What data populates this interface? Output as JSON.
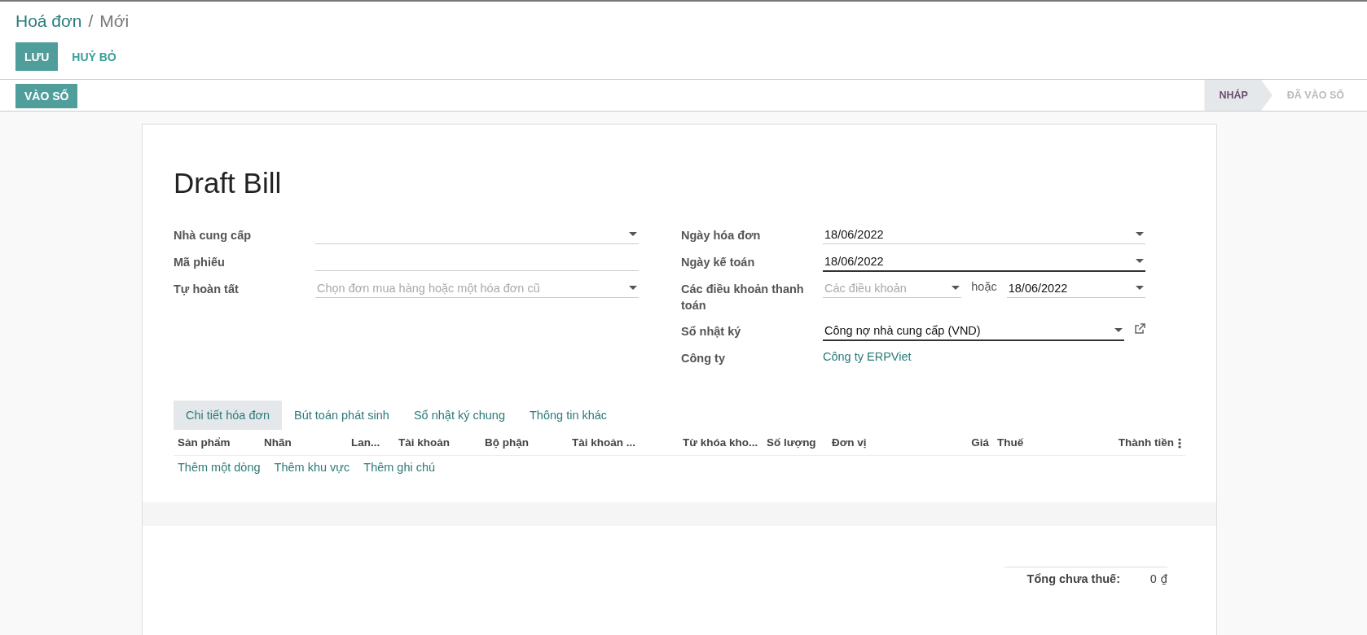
{
  "breadcrumb": {
    "items": [
      {
        "label": "Hoá đơn",
        "kind": "link"
      },
      {
        "label": "Mới",
        "kind": "current"
      }
    ],
    "separator": "/"
  },
  "buttons": [
    {
      "label": "LƯU",
      "kind": "primary"
    },
    {
      "label": "HUỶ BỎ",
      "kind": "link"
    }
  ],
  "action_buttons": [
    {
      "label": "VÀO SỔ"
    }
  ],
  "status_steps": [
    {
      "label": "NHÁP",
      "selected": true
    },
    {
      "label": "ĐÃ VÀO SỔ",
      "selected": false
    }
  ],
  "sheet": {
    "title": "Draft Bill",
    "left_fields": [
      {
        "label": "Nhà cung cấp",
        "kind": "select",
        "highlighted": false
      },
      {
        "label": "Mã phiếu",
        "kind": "text",
        "highlighted": false
      },
      {
        "label": "Tự hoàn tất",
        "kind": "select",
        "placeholder": "Chọn đơn mua hàng hoặc một hóa đơn cũ",
        "highlighted": false
      }
    ],
    "right_fields": [
      {
        "label": "Ngày hóa đơn",
        "kind": "select",
        "value": "18/06/2022",
        "highlighted": false
      },
      {
        "label": "Ngày kế toán",
        "kind": "select",
        "value": "18/06/2022",
        "highlighted": true
      },
      {
        "label": "Các điều khoản thanh toán",
        "kind": "terms",
        "placeholder": "Các điều khoản",
        "connector": "hoặc",
        "value": "18/06/2022"
      },
      {
        "label": "Sổ nhật ký",
        "kind": "select",
        "value": "Công nợ nhà cung cấp (VND)",
        "highlighted": true,
        "external_link": true
      },
      {
        "label": "Công ty",
        "kind": "link",
        "value": "Công ty ERPViet"
      }
    ]
  },
  "tabs": [
    {
      "label": "Chi tiết hóa đơn",
      "selected": true
    },
    {
      "label": "Bút toán phát sinh",
      "selected": false
    },
    {
      "label": "Sổ nhật ký chung",
      "selected": false
    },
    {
      "label": "Thông tin khác",
      "selected": false
    }
  ],
  "table": {
    "columns": [
      {
        "label": "Sản phẩm",
        "kind": "text"
      },
      {
        "label": "Nhãn",
        "kind": "text"
      },
      {
        "label": "Lan...",
        "kind": "text"
      },
      {
        "label": "Tài khoản",
        "kind": "text"
      },
      {
        "label": "Bộ phận",
        "kind": "text"
      },
      {
        "label": "Tài khoản ...",
        "kind": "text"
      },
      {
        "label": "Từ khóa kho...",
        "kind": "text"
      },
      {
        "label": "Số lượng",
        "kind": "text"
      },
      {
        "label": "Đơn vị",
        "kind": "text"
      },
      {
        "label": "Giá",
        "kind": "number"
      },
      {
        "label": "Thuế",
        "kind": "text"
      },
      {
        "label": "Thành tiền",
        "kind": "number"
      }
    ],
    "actions": [
      "Thêm một dòng",
      "Thêm khu vực",
      "Thêm ghi chú"
    ]
  },
  "totals": [
    {
      "label": "Tổng chưa thuế:",
      "value": "0 ₫"
    }
  ]
}
